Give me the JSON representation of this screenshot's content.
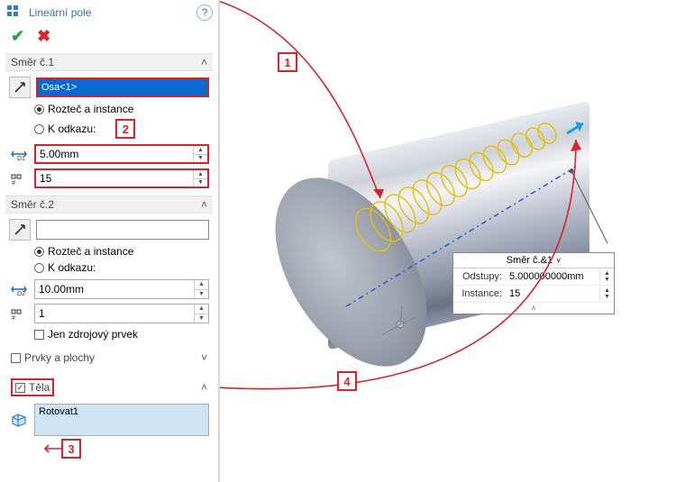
{
  "feature": {
    "title": "Lineární pole"
  },
  "dir1": {
    "header": "Směr č.1",
    "selection": "Osa<1>",
    "opt_spacing": "Rozteč a instance",
    "opt_ref": "K odkazu:",
    "spacing": "5.00mm",
    "count": "15"
  },
  "dir2": {
    "header": "Směr č.2",
    "opt_spacing": "Rozteč a instance",
    "opt_ref": "K odkazu:",
    "spacing": "10.00mm",
    "count": "1",
    "seed_only": "Jen zdrojový prvek"
  },
  "features_faces": {
    "header": "Prvky a plochy"
  },
  "bodies": {
    "header": "Těla",
    "item": "Rotovat1"
  },
  "callouts": {
    "c1": "1",
    "c2": "2",
    "c3": "3",
    "c4": "4"
  },
  "popup": {
    "header": "Směr č.&1",
    "spacing_label": "Odstupy:",
    "spacing_value": "5.000000000mm",
    "instances_label": "Instance:",
    "instances_value": "15"
  }
}
